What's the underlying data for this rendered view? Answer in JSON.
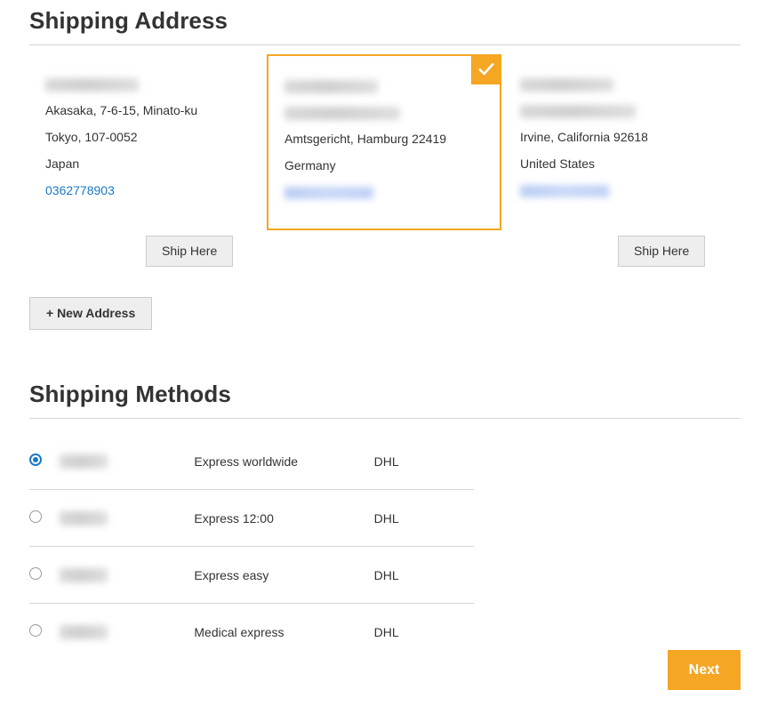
{
  "colors": {
    "accent_orange": "#f5a623",
    "link_blue": "#1979c3",
    "text": "#333333",
    "rule": "#d6d6d6",
    "button_grey": "#eeeeee"
  },
  "shipping_address": {
    "title": "Shipping Address",
    "new_address_label": "+ New Address",
    "ship_here_label": "Ship Here",
    "selected_badge_icon": "check-icon",
    "cards": [
      {
        "selected": false,
        "name_redacted": true,
        "company_redacted": false,
        "street": "Akasaka, 7-6-15, Minato-ku",
        "city_state_zip": "Tokyo, 107-0052",
        "country": "Japan",
        "phone": "0362778903",
        "phone_redacted": false,
        "has_ship_here": true
      },
      {
        "selected": true,
        "name_redacted": true,
        "company_redacted": true,
        "street": "Amtsgericht, Hamburg 22419",
        "city_state_zip": "",
        "country": "Germany",
        "phone": "",
        "phone_redacted": true,
        "has_ship_here": false
      },
      {
        "selected": false,
        "name_redacted": true,
        "company_redacted": true,
        "street": "Irvine, California 92618",
        "city_state_zip": "",
        "country": "United States",
        "phone": "",
        "phone_redacted": true,
        "has_ship_here": true
      }
    ]
  },
  "shipping_methods": {
    "title": "Shipping Methods",
    "rows": [
      {
        "selected": true,
        "price_redacted": true,
        "method": "Express worldwide",
        "carrier": "DHL"
      },
      {
        "selected": false,
        "price_redacted": true,
        "method": "Express 12:00",
        "carrier": "DHL"
      },
      {
        "selected": false,
        "price_redacted": true,
        "method": "Express easy",
        "carrier": "DHL"
      },
      {
        "selected": false,
        "price_redacted": true,
        "method": "Medical express",
        "carrier": "DHL"
      }
    ]
  },
  "footer": {
    "next_label": "Next"
  }
}
